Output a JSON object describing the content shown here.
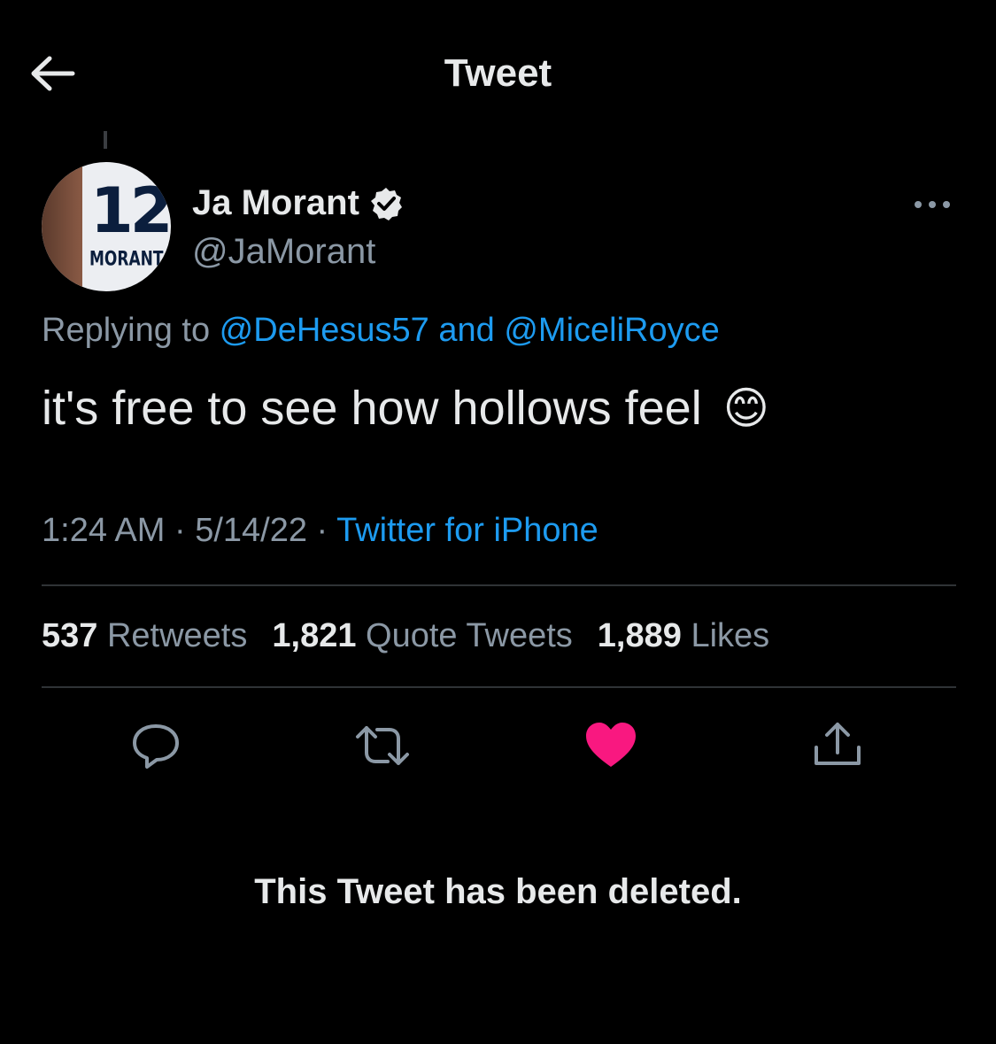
{
  "header": {
    "title": "Tweet",
    "back_icon": "arrow-left-icon"
  },
  "author": {
    "avatar_number": "12",
    "avatar_name": "MORANT",
    "name": "Ja Morant",
    "handle": "@JaMorant",
    "verified_icon": "verified-badge-icon"
  },
  "reply": {
    "prefix": "Replying to ",
    "user1": "@DeHesus57",
    "joiner": " and ",
    "user2": "@MiceliRoyce"
  },
  "tweet": {
    "text": "it's free to see how hollows feel",
    "emoji": "😊"
  },
  "meta": {
    "time": "1:24 AM",
    "sep1": " · ",
    "date": "5/14/22",
    "sep2": " · ",
    "source": "Twitter for iPhone"
  },
  "stats": {
    "retweets_count": "537",
    "retweets_label": " Retweets",
    "quotes_count": "1,821",
    "quotes_label": " Quote Tweets",
    "likes_count": "1,889",
    "likes_label": " Likes"
  },
  "actions": [
    "reply-icon",
    "retweet-icon",
    "like-heart-icon",
    "share-icon"
  ],
  "colors": {
    "background": "#000000",
    "link": "#1d9bf0",
    "like": "#f91880",
    "muted": "#8b98a5"
  },
  "deleted_notice": "This Tweet has been deleted."
}
